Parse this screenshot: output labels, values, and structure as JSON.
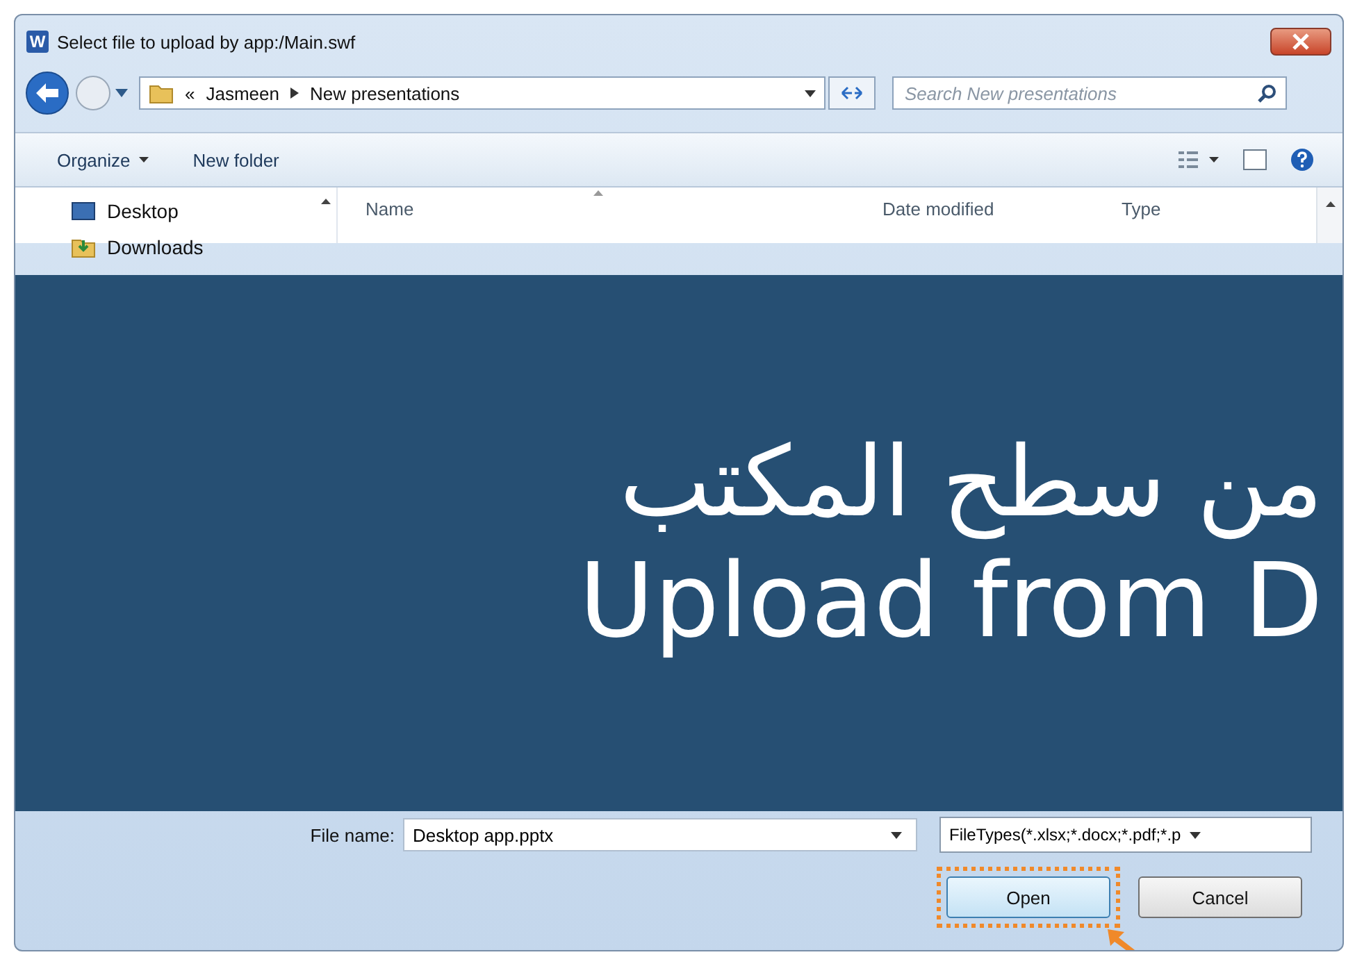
{
  "window": {
    "title": "Select file to upload by app:/Main.swf",
    "app_icon_letter": "W"
  },
  "address": {
    "overflow": "«",
    "breadcrumbs": [
      "Jasmeen",
      "New presentations"
    ]
  },
  "search": {
    "placeholder": "Search New presentations"
  },
  "toolbar": {
    "buttons": [
      {
        "label": "Organize",
        "dropdown": true
      },
      {
        "label": "New folder",
        "dropdown": false
      }
    ]
  },
  "nav_pane": {
    "items": [
      {
        "label": "Desktop",
        "kind": "desktop"
      },
      {
        "label": "Downloads",
        "kind": "downloads"
      }
    ]
  },
  "columns": [
    "Name",
    "Date modified",
    "Type"
  ],
  "banner": {
    "lines": [
      "من سطح المكتب",
      "Upload from D"
    ]
  },
  "file_name": {
    "label": "File name:",
    "value": "Desktop app.pptx"
  },
  "file_type": {
    "value": "FileTypes(*.xlsx;*.docx;*.pdf;*.p"
  },
  "buttons": [
    {
      "label": "Open",
      "highlighted": true
    },
    {
      "label": "Cancel",
      "highlighted": false
    }
  ]
}
